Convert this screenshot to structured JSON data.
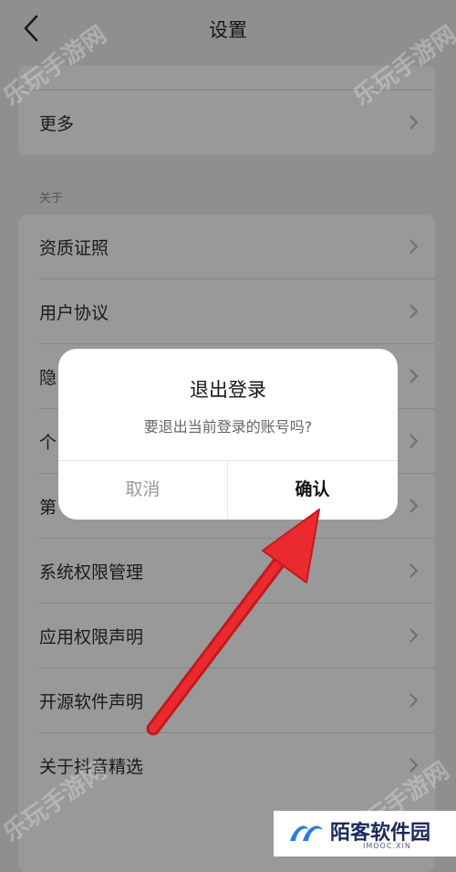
{
  "header": {
    "title": "设置",
    "back_icon": "chevron-left-icon"
  },
  "sections": [
    {
      "label": "",
      "items": [
        {
          "label": "更多"
        }
      ]
    },
    {
      "label": "关于",
      "items": [
        {
          "label": "资质证照"
        },
        {
          "label": "用户协议"
        },
        {
          "label": "隐"
        },
        {
          "label": "个"
        },
        {
          "label": "第"
        },
        {
          "label": "系统权限管理"
        },
        {
          "label": "应用权限声明"
        },
        {
          "label": "开源软件声明"
        },
        {
          "label": "关于抖音精选"
        }
      ]
    }
  ],
  "dialog": {
    "title": "退出登录",
    "message": "要退出当前登录的账号吗?",
    "cancel_label": "取消",
    "confirm_label": "确认"
  },
  "watermark": {
    "text": "乐玩手游网"
  },
  "brand": {
    "name": "陌客软件园",
    "domain": "IMOOC.XIN",
    "logo_icon": "brand-logo-icon"
  },
  "colors": {
    "arrow": "#e8262a",
    "overlay": "#8f8f8f",
    "dialog_bg": "#ffffff"
  }
}
